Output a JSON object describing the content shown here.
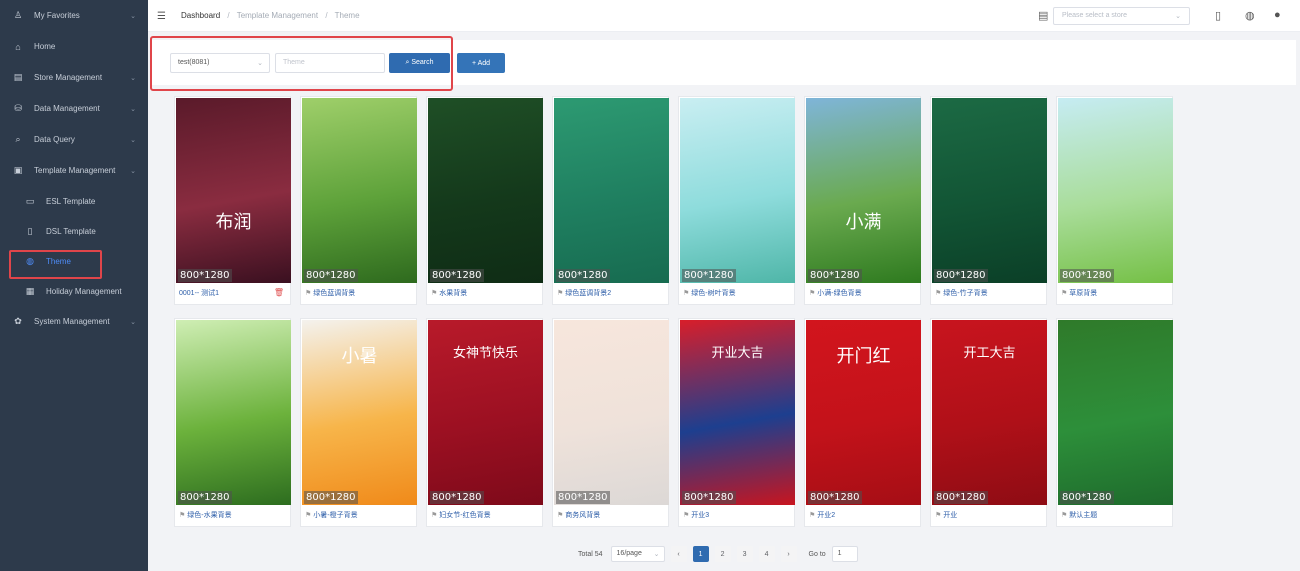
{
  "sidebar": {
    "items": [
      {
        "label": "My Favorites",
        "icon": "user-icon",
        "glyph": "♙",
        "chevron": true
      },
      {
        "label": "Home",
        "icon": "home-icon",
        "glyph": "⌂",
        "chevron": false
      },
      {
        "label": "Store Management",
        "icon": "store-icon",
        "glyph": "▤",
        "chevron": true
      },
      {
        "label": "Data Management",
        "icon": "database-icon",
        "glyph": "⛁",
        "chevron": true
      },
      {
        "label": "Data Query",
        "icon": "search-icon",
        "glyph": "⌕",
        "chevron": true
      },
      {
        "label": "Template Management",
        "icon": "template-icon",
        "glyph": "▣",
        "chevron": true
      }
    ],
    "sub_items": [
      {
        "label": "ESL Template",
        "icon": "monitor-icon",
        "glyph": "▭"
      },
      {
        "label": "DSL Template",
        "icon": "tablet-icon",
        "glyph": "▯"
      },
      {
        "label": "Theme",
        "icon": "theme-icon",
        "glyph": "◍"
      }
    ],
    "after_items": [
      {
        "label": "Holiday Management",
        "icon": "calendar-icon",
        "glyph": "▦"
      }
    ],
    "system_item": {
      "label": "System Management",
      "icon": "gear-icon",
      "glyph": "✿"
    }
  },
  "header": {
    "breadcrumb": [
      "Dashboard",
      "Template Management",
      "Theme"
    ],
    "store_placeholder": "Please select a store"
  },
  "search": {
    "store_value": "test(8081)",
    "theme_placeholder": "Theme",
    "search_label": "⌕ Search",
    "add_label": "+ Add"
  },
  "themes": [
    {
      "caption": "0001-- 测试1",
      "size": "800*1280",
      "colors": [
        "#5a1a2a",
        "#8a2c40",
        "#3a1020"
      ],
      "text": "布润",
      "deletable": true
    },
    {
      "caption": "绿色蓝调背景",
      "size": "800*1280",
      "colors": [
        "#9fcf6a",
        "#5ea23a",
        "#2e6a1e"
      ],
      "text": ""
    },
    {
      "caption": "水果背景",
      "size": "800*1280",
      "colors": [
        "#1f4f26",
        "#14391b",
        "#0f2c15"
      ],
      "text": ""
    },
    {
      "caption": "绿色蓝调背景2",
      "size": "800*1280",
      "colors": [
        "#2d9a72",
        "#1f7f60",
        "#176b50"
      ],
      "text": ""
    },
    {
      "caption": "绿色-树叶背景",
      "size": "800*1280",
      "colors": [
        "#c9eef2",
        "#8edcdc",
        "#4fb6a8"
      ],
      "text": ""
    },
    {
      "caption": "小满-绿色背景",
      "size": "800*1280",
      "colors": [
        "#7fb5d9",
        "#6aaa4f",
        "#2e7a1f"
      ],
      "text": "小满"
    },
    {
      "caption": "绿色-竹子背景",
      "size": "800*1280",
      "colors": [
        "#1c6a44",
        "#125535",
        "#0b3f27"
      ],
      "text": ""
    },
    {
      "caption": "草原背景",
      "size": "800*1280",
      "colors": [
        "#c6ecf3",
        "#a9dd9a",
        "#75c046"
      ],
      "text": ""
    },
    {
      "caption": "绿色-水果背景",
      "size": "800*1280",
      "colors": [
        "#cfeeb4",
        "#6cb23c",
        "#2d6d1f"
      ],
      "text": ""
    },
    {
      "caption": "小暑-橙子背景",
      "size": "800*1280",
      "colors": [
        "#f4f2ee",
        "#f7b54a",
        "#f08a1a"
      ],
      "text": "小暑"
    },
    {
      "caption": "妇女节-红色背景",
      "size": "800*1280",
      "colors": [
        "#b81a2a",
        "#9c1022",
        "#7e0a1a"
      ],
      "text": "女神节快乐"
    },
    {
      "caption": "商务风背景",
      "size": "800*1280",
      "colors": [
        "#f7e6dc",
        "#efe2da",
        "#dcd8d6"
      ],
      "text": ""
    },
    {
      "caption": "开业3",
      "size": "800*1280",
      "colors": [
        "#d81e2a",
        "#1d3f8f",
        "#c8151f"
      ],
      "text": "开业大吉"
    },
    {
      "caption": "开业2",
      "size": "800*1280",
      "colors": [
        "#d2151d",
        "#c3121a",
        "#a50e15"
      ],
      "text": "开门红"
    },
    {
      "caption": "开业",
      "size": "800*1280",
      "colors": [
        "#c8141e",
        "#b01018",
        "#8e0c14"
      ],
      "text": "开工大吉"
    },
    {
      "caption": "默认主题",
      "size": "800*1280",
      "colors": [
        "#2f7a2a",
        "#2d8f3a",
        "#1e6b2c"
      ],
      "text": ""
    }
  ],
  "pagination": {
    "total_label": "Total 54",
    "page_size": "16/page",
    "pages": [
      "1",
      "2",
      "3",
      "4"
    ],
    "active_page": "1",
    "goto_label": "Go to",
    "goto_value": "1"
  },
  "colors": {
    "sidebar_bg": "#2d3a4b",
    "accent": "#2f6bb0",
    "highlight": "#e0454a"
  }
}
